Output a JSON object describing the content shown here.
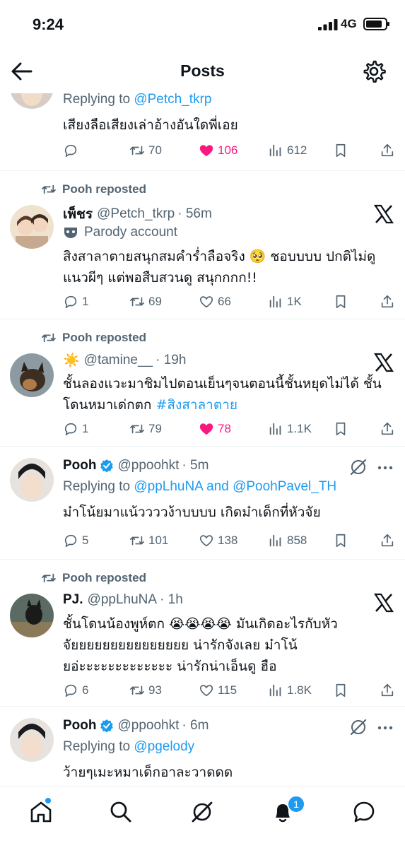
{
  "status": {
    "time": "9:24",
    "network": "4G",
    "battery_level": 0.85
  },
  "header": {
    "title": "Posts"
  },
  "posts": [
    {
      "replying_label": "Replying to",
      "replying_to": "@Petch_tkrp",
      "text": "เสียงลือเสียงเล่าอ้างอันใดพี่เอย",
      "stats": {
        "replies": "",
        "reposts": "70",
        "likes": "106",
        "views": "612"
      }
    },
    {
      "reposted_by": "Pooh reposted",
      "name": "เพ็ชร",
      "handle": "@Petch_tkrp",
      "time": "· 56m",
      "parody": "Parody account",
      "text": "สิงสาลาตายสนุกสมคำร่ำลือจริง 🥺 ชอบบบบ ปกติไม่ดูแนวผีๆ แต่พอสืบสวนดู สนุกกกก!!",
      "stats": {
        "replies": "1",
        "reposts": "69",
        "likes": "66",
        "views": "1K"
      }
    },
    {
      "reposted_by": "Pooh reposted",
      "name": "☀️",
      "handle": "@tamine__",
      "time": "· 19h",
      "text": "ชั้นลองแวะมาชิมไปตอนเย็นๆจนตอนนี้ชั้นหยุดไม่ได้ ชั้น โดนหมาเด่กตก ",
      "hashtag": "#สิงสาลาตาย",
      "stats": {
        "replies": "1",
        "reposts": "79",
        "likes": "78",
        "views": "1.1K"
      }
    },
    {
      "name": "Pooh",
      "handle": "@ppoohkt",
      "time": "· 5m",
      "replying_label": "Replying to",
      "replying_to": "@ppLhuNA and @PoohPavel_TH",
      "text": "ม๋าโน้ยมาแน้ววววง้าบบบบ เกิดม๋าเด็กที่หัวจัย",
      "stats": {
        "replies": "5",
        "reposts": "101",
        "likes": "138",
        "views": "858"
      }
    },
    {
      "reposted_by": "Pooh reposted",
      "name": "PJ.",
      "handle": "@ppLhuNA",
      "time": "· 1h",
      "text": "ชั้นโดนน้องพูห์ตก 😭😭😭😭 มันเกิดอะไรกับหัวจัยยยยยยยยยยยยยยย น่ารักจังเลย ม๋าโน้ยอ่ะะะะะะะะะะะะะ น่ารักน่าเอ็นดู ฮือ",
      "stats": {
        "replies": "6",
        "reposts": "93",
        "likes": "115",
        "views": "1.8K"
      }
    },
    {
      "name": "Pooh",
      "handle": "@ppoohkt",
      "time": "· 6m",
      "replying_label": "Replying to",
      "replying_to": "@pgelody",
      "text": "ว้ายๆเมะหมาเด็กอาละวาดดด"
    }
  ],
  "nav": {
    "notification_count": "1"
  },
  "colors": {
    "accent": "#1d9bf0",
    "like": "#f91880",
    "muted": "#536471"
  }
}
